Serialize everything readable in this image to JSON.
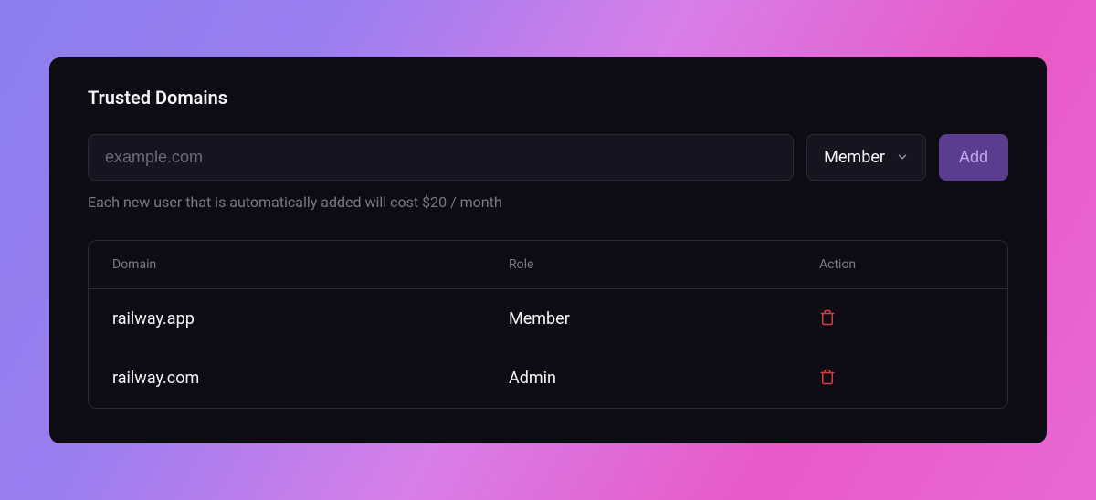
{
  "title": "Trusted Domains",
  "input": {
    "placeholder": "example.com"
  },
  "role_select": {
    "selected": "Member"
  },
  "add_button": "Add",
  "help_text": "Each new user that is automatically added will cost $20 / month",
  "table": {
    "headers": {
      "domain": "Domain",
      "role": "Role",
      "action": "Action"
    },
    "rows": [
      {
        "domain": "railway.app",
        "role": "Member"
      },
      {
        "domain": "railway.com",
        "role": "Admin"
      }
    ]
  }
}
